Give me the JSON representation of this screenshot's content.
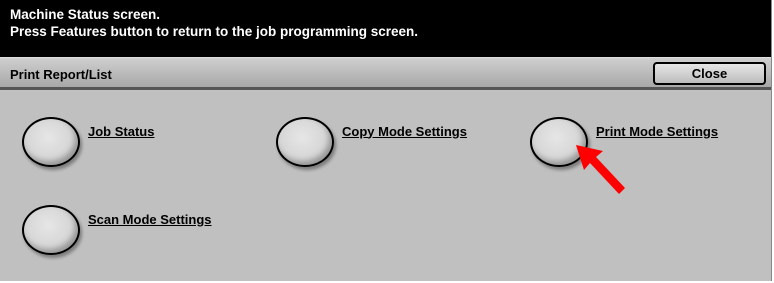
{
  "message": {
    "line1": "Machine Status screen.",
    "line2": "Press Features button to return to the job programming screen."
  },
  "title_bar": {
    "title": "Print Report/List",
    "close_label": "Close"
  },
  "options": {
    "job_status": "Job Status",
    "copy_mode_settings": "Copy Mode Settings",
    "print_mode_settings": "Print Mode Settings",
    "scan_mode_settings": "Scan Mode Settings"
  },
  "annotation": {
    "arrow_color": "#ff0000",
    "arrow_target": "print-mode-settings-button"
  }
}
